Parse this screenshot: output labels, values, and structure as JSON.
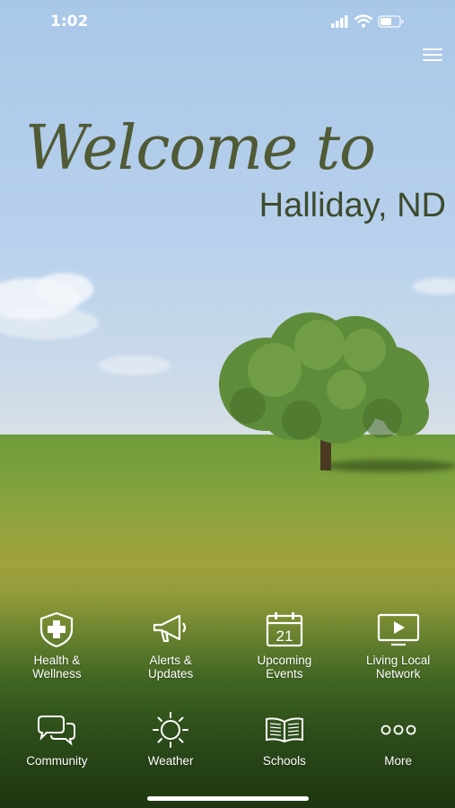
{
  "status_bar": {
    "time": "1:02"
  },
  "header": {
    "welcome": "Welcome to",
    "town": "Halliday, ND"
  },
  "grid": {
    "items": [
      {
        "label": "Health & Wellness",
        "line1": "Health &",
        "line2": "Wellness",
        "icon": "shield-cross-icon"
      },
      {
        "label": "Alerts & Updates",
        "line1": "Alerts &",
        "line2": "Updates",
        "icon": "megaphone-icon"
      },
      {
        "label": "Upcoming Events",
        "line1": "Upcoming",
        "line2": "Events",
        "icon": "calendar-icon",
        "day": "21"
      },
      {
        "label": "Living Local Network",
        "line1": "Living Local",
        "line2": "Network",
        "icon": "tv-play-icon"
      },
      {
        "label": "Community",
        "icon": "chat-bubbles-icon"
      },
      {
        "label": "Weather",
        "icon": "sun-icon"
      },
      {
        "label": "Schools",
        "icon": "book-icon"
      },
      {
        "label": "More",
        "icon": "more-dots-icon"
      }
    ]
  },
  "colors": {
    "title": "#505a35",
    "label": "#ffffff"
  }
}
